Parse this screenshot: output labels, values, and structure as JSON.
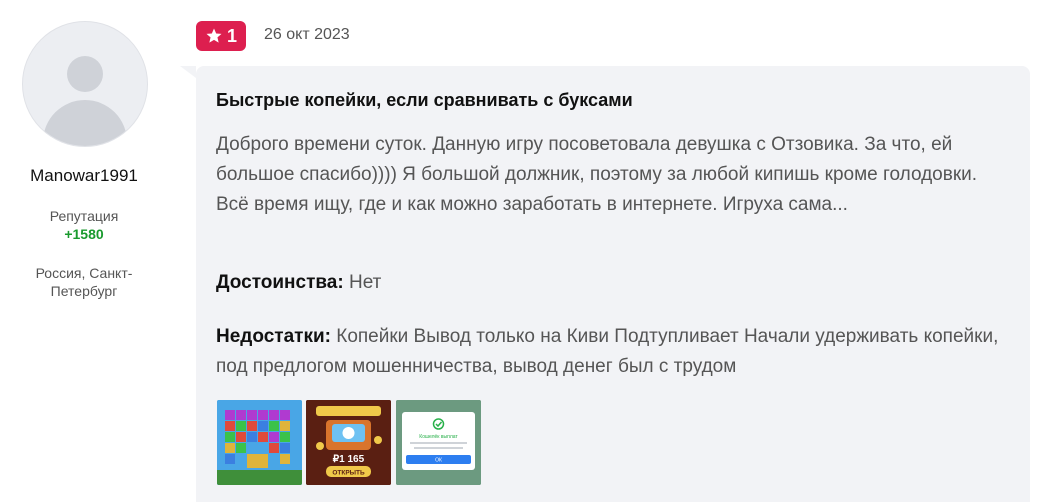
{
  "author": {
    "username": "Manowar1991",
    "reputation_label": "Репутация",
    "reputation_value": "+1580",
    "location": "Россия, Санкт-Петербург"
  },
  "review": {
    "rating": "1",
    "date": "26 окт 2023",
    "title": "Быстрые копейки, если сравнивать с буксами",
    "text": "Доброго времени суток. Данную игру посоветовала девушка с Отзовика. За что, ей большое спасибо)))) Я большой должник, поэтому за любой кипишь кроме голодовки. Всё время ищу, где и как можно заработать в интернете. Игруха сама...",
    "pros_label": "Достоинства:",
    "pros_text": "Нет",
    "cons_label": "Недостатки:",
    "cons_text": "Копейки Вывод только на Киви Подтупливает Начали удерживать копейки, под предлогом мошенничества, вывод денег был с трудом",
    "thumb2_amount": "₽1 165",
    "thumb2_button": "ОТКРЫТЬ",
    "thumb3_title": "Кошелёк выплат",
    "thumb3_button": "ОК"
  },
  "colors": {
    "badge": "#dd1f4f",
    "card_bg": "#f2f3f6",
    "reputation": "#1a9a2e"
  }
}
